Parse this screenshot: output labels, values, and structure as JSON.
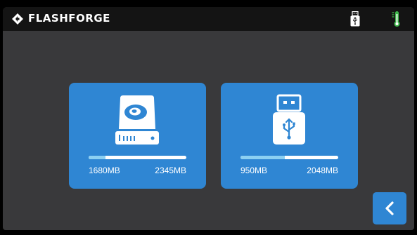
{
  "header": {
    "brand": "FLASHFORGE",
    "icons": [
      "flashforge-logo-icon",
      "usb-status-icon",
      "thermometer-icon"
    ]
  },
  "storage": [
    {
      "id": "internal",
      "icon": "hard-drive-icon",
      "used_label": "1680MB",
      "total_label": "2345MB",
      "used_fraction": 0.17
    },
    {
      "id": "usb",
      "icon": "usb-drive-icon",
      "used_label": "950MB",
      "total_label": "2048MB",
      "used_fraction": 0.45
    }
  ],
  "navigation": {
    "back_icon": "chevron-left-icon"
  },
  "colors": {
    "background": "#39393b",
    "header": "#141414",
    "accent": "#2f86d3",
    "bar_fill": "#8cd0f2",
    "bar_track": "#ffffff",
    "thermometer": "#3db84a"
  }
}
